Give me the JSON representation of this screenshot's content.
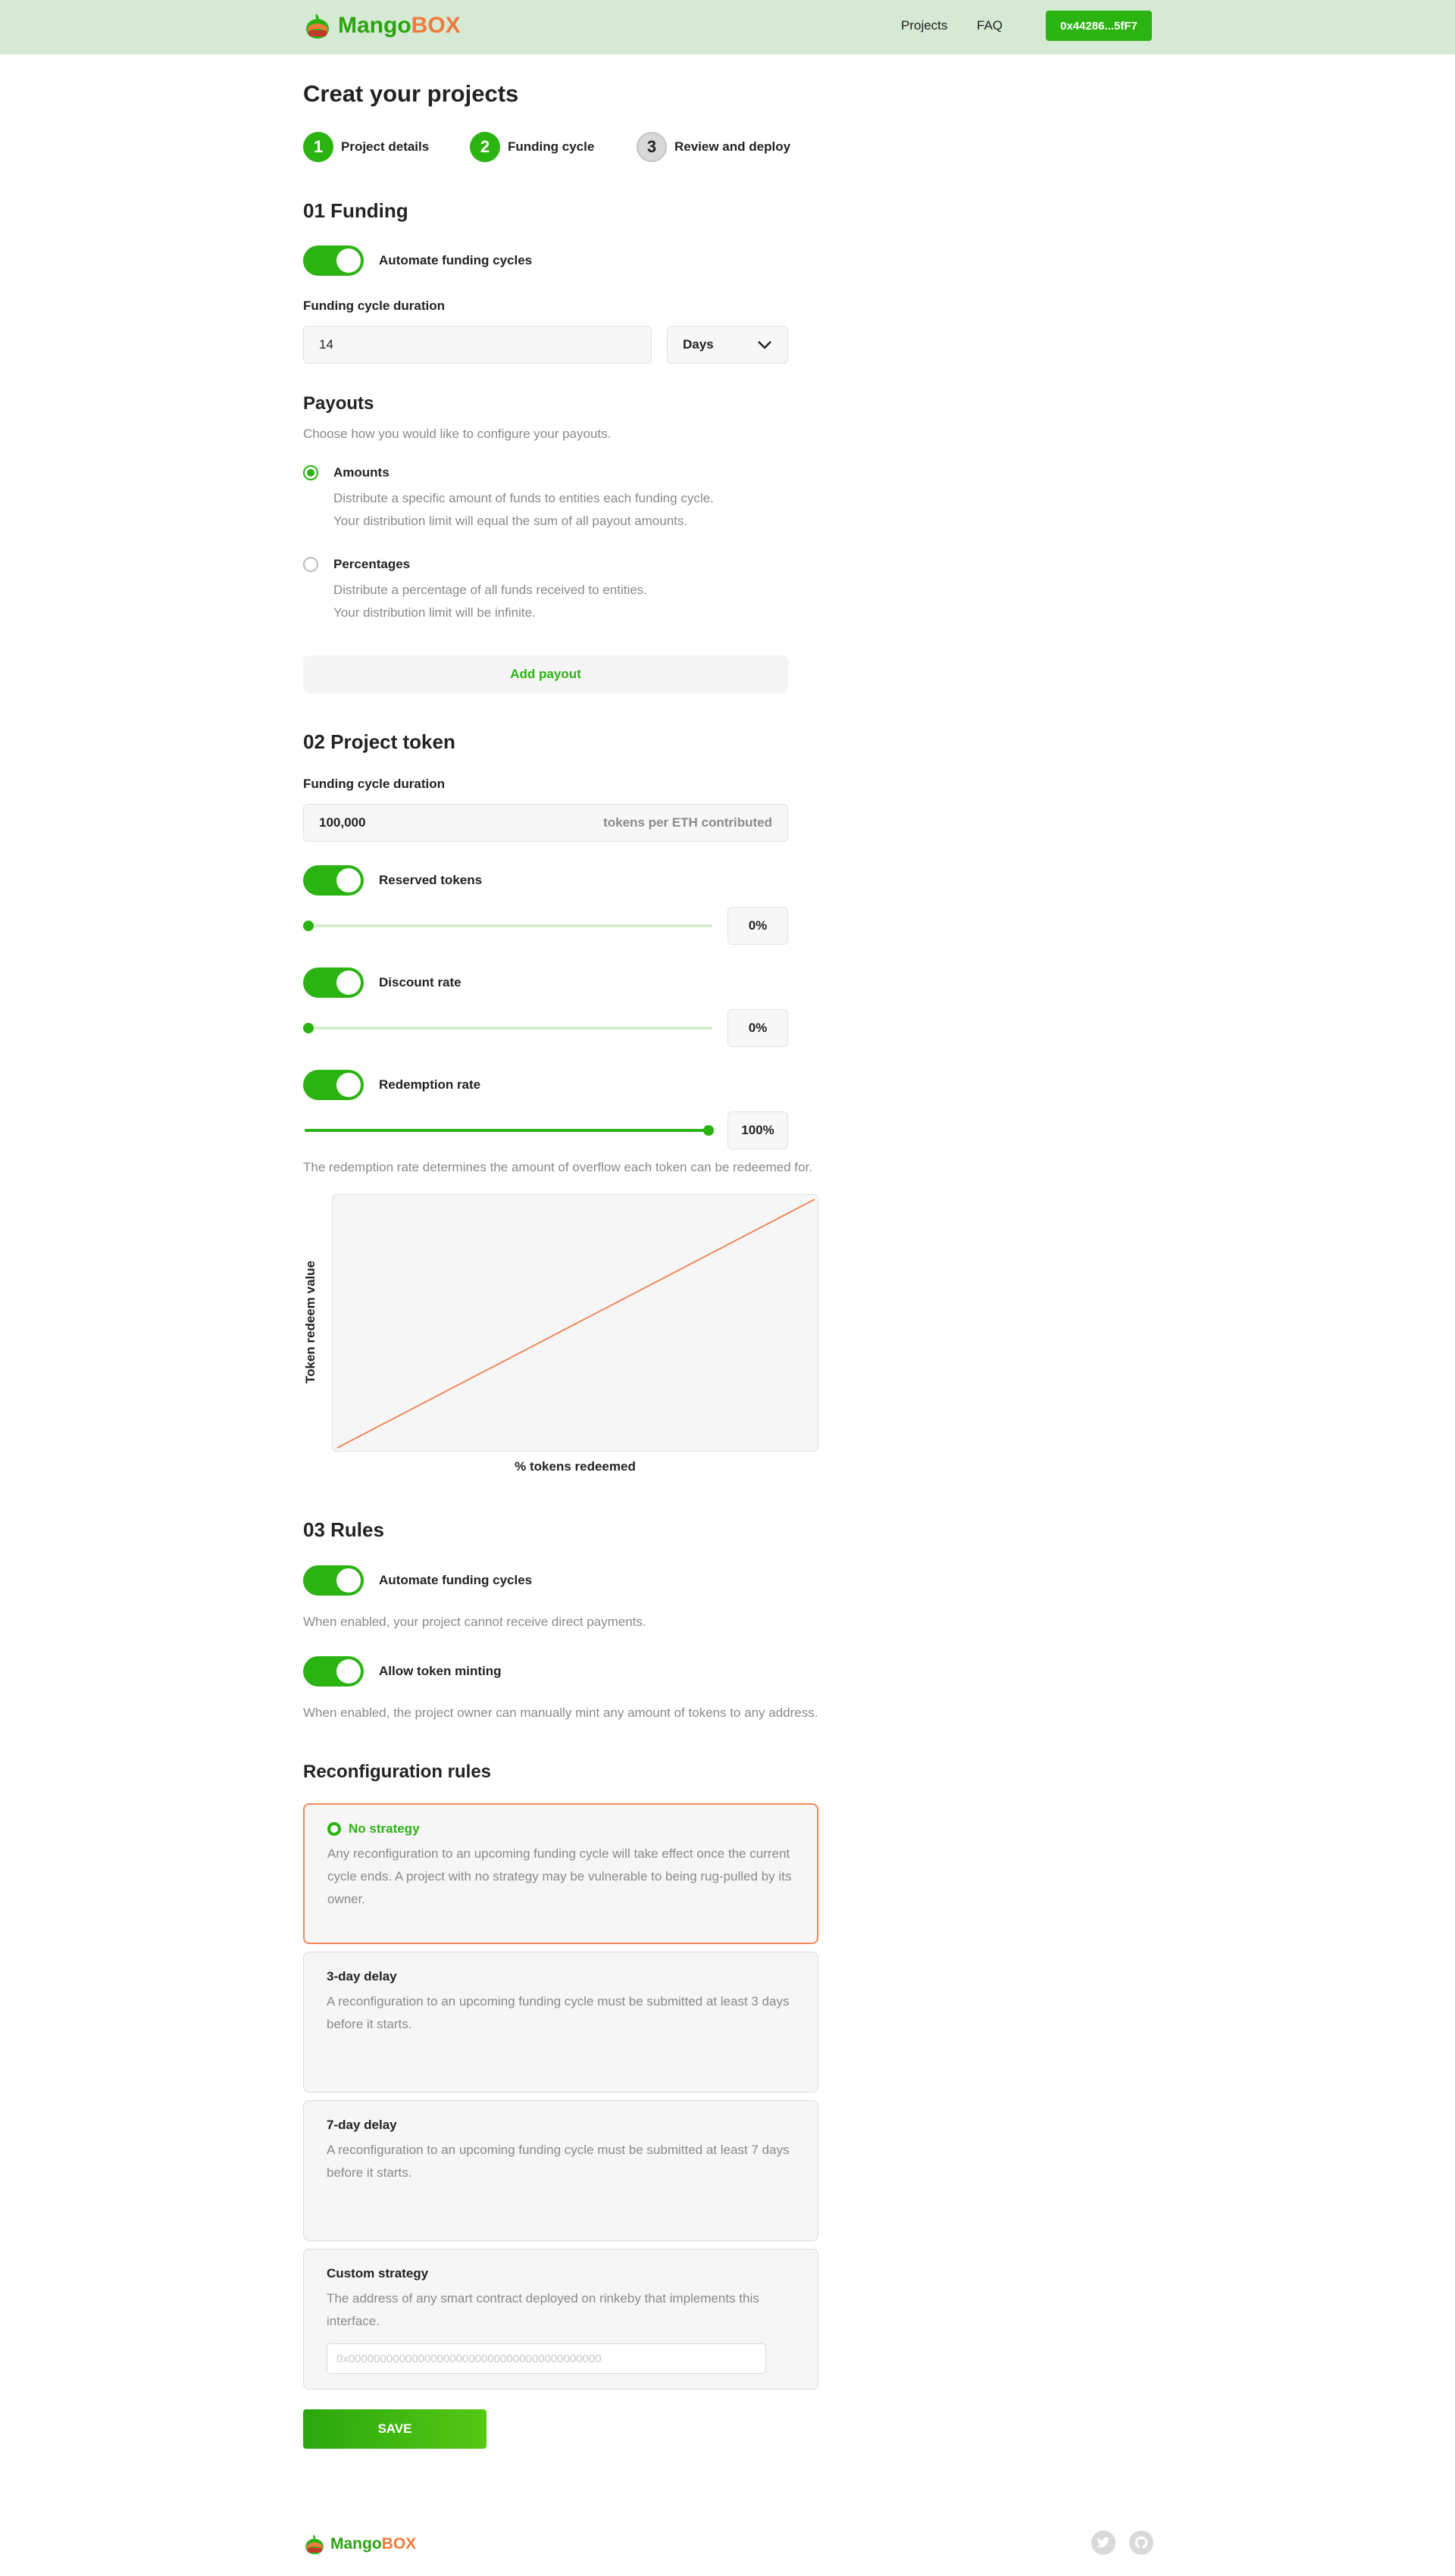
{
  "brand": {
    "name_part1": "Mango",
    "name_part2": "BOX",
    "primary_color": "#2bb312",
    "accent_color": "#f07a3d",
    "header_bg": "#d5e9d4"
  },
  "header": {
    "nav": [
      "Projects",
      "FAQ"
    ],
    "wallet": "0x44286...5fF7"
  },
  "page": {
    "title": "Creat your projects"
  },
  "steps": [
    {
      "number": "1",
      "label": "Project details",
      "active": true
    },
    {
      "number": "2",
      "label": "Funding cycle",
      "active": true
    },
    {
      "number": "3",
      "label": "Review and deploy",
      "active": false
    }
  ],
  "funding": {
    "heading": "01 Funding",
    "automate_label": "Automate funding cycles",
    "automate_on": true,
    "duration_label": "Funding cycle duration",
    "duration_value": "14",
    "duration_unit": "Days"
  },
  "payouts": {
    "heading": "Payouts",
    "subtitle": "Choose how you would like to configure your payouts.",
    "options": [
      {
        "label": "Amounts",
        "checked": true,
        "desc1": "Distribute a specific amount of funds to entities each funding cycle.",
        "desc2": "Your distribution limit will equal the sum of all payout amounts."
      },
      {
        "label": "Percentages",
        "checked": false,
        "desc1": "Distribute a percentage of all funds received to entities.",
        "desc2": "Your distribution limit will be infinite."
      }
    ],
    "add_label": "Add payout"
  },
  "token": {
    "heading": "02 Project token",
    "duration_label": "Funding cycle duration",
    "amount": "100,000",
    "amount_suffix": "tokens per ETH contributed",
    "sliders": [
      {
        "label": "Reserved tokens",
        "value": 0,
        "display": "0%"
      },
      {
        "label": "Discount rate",
        "value": 0,
        "display": "0%"
      },
      {
        "label": "Redemption rate",
        "value": 100,
        "display": "100%"
      }
    ],
    "note": "The redemption rate determines the amount of overflow each token can be redeemed for."
  },
  "chart_data": {
    "type": "line",
    "title": "",
    "xlabel": "% tokens redeemed",
    "ylabel": "Token redeem value",
    "xlim": [
      0,
      100
    ],
    "ylim": [
      0,
      100
    ],
    "series": [
      {
        "x": [
          0,
          100
        ],
        "y": [
          0,
          100
        ],
        "color": "#f08a5d"
      }
    ]
  },
  "rules": {
    "heading": "03 Rules",
    "items": [
      {
        "label": "Automate funding cycles",
        "desc": "When enabled, your project cannot receive direct payments.",
        "on": true
      },
      {
        "label": "Allow token minting",
        "desc": "When enabled, the project owner can manually mint any amount of tokens to any address.",
        "on": true
      }
    ]
  },
  "reconfig": {
    "heading": "Reconfiguration rules",
    "strategies": [
      {
        "title": "No strategy",
        "desc": "Any reconfiguration to an upcoming funding cycle will take effect once the current cycle ends. A project with no strategy may be vulnerable to being rug-pulled by its owner.",
        "selected": true
      },
      {
        "title": "3-day delay",
        "desc": "A reconfiguration to an upcoming funding cycle must be submitted at least 3 days before it starts.",
        "selected": false
      },
      {
        "title": "7-day delay",
        "desc": "A reconfiguration to an upcoming funding cycle must be submitted at least 7 days before it starts.",
        "selected": false
      },
      {
        "title": "Custom strategy",
        "desc": "The address of any smart contract deployed on rinkeby that implements this interface.",
        "selected": false,
        "placeholder": "0x0000000000000000000000000000000000000000"
      }
    ]
  },
  "actions": {
    "save": "SAVE"
  },
  "footer": {
    "icons": [
      "twitter-icon",
      "github-icon"
    ]
  }
}
